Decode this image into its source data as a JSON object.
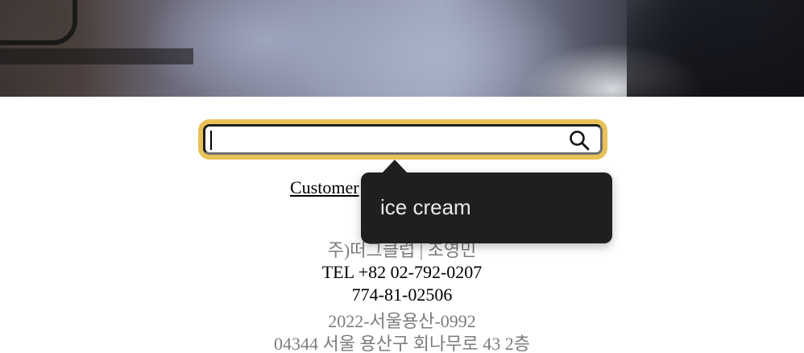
{
  "search": {
    "value": "",
    "placeholder": ""
  },
  "footer": {
    "customer_link": "Customer",
    "company": "주)떠그클럽 | 조영민",
    "tel": "TEL +82 02-792-0207",
    "biz_number": "774-81-02506",
    "license": "2022-서울용산-0992",
    "address": "04344 서울 용산구 회나무로 43 2층"
  },
  "suggestion": {
    "text": "ice cream"
  },
  "icons": {
    "search": "search-icon"
  },
  "colors": {
    "focus_ring": "#e8c257",
    "tooltip_bg": "#1f1f1f",
    "muted_text": "#7c7c7c"
  }
}
